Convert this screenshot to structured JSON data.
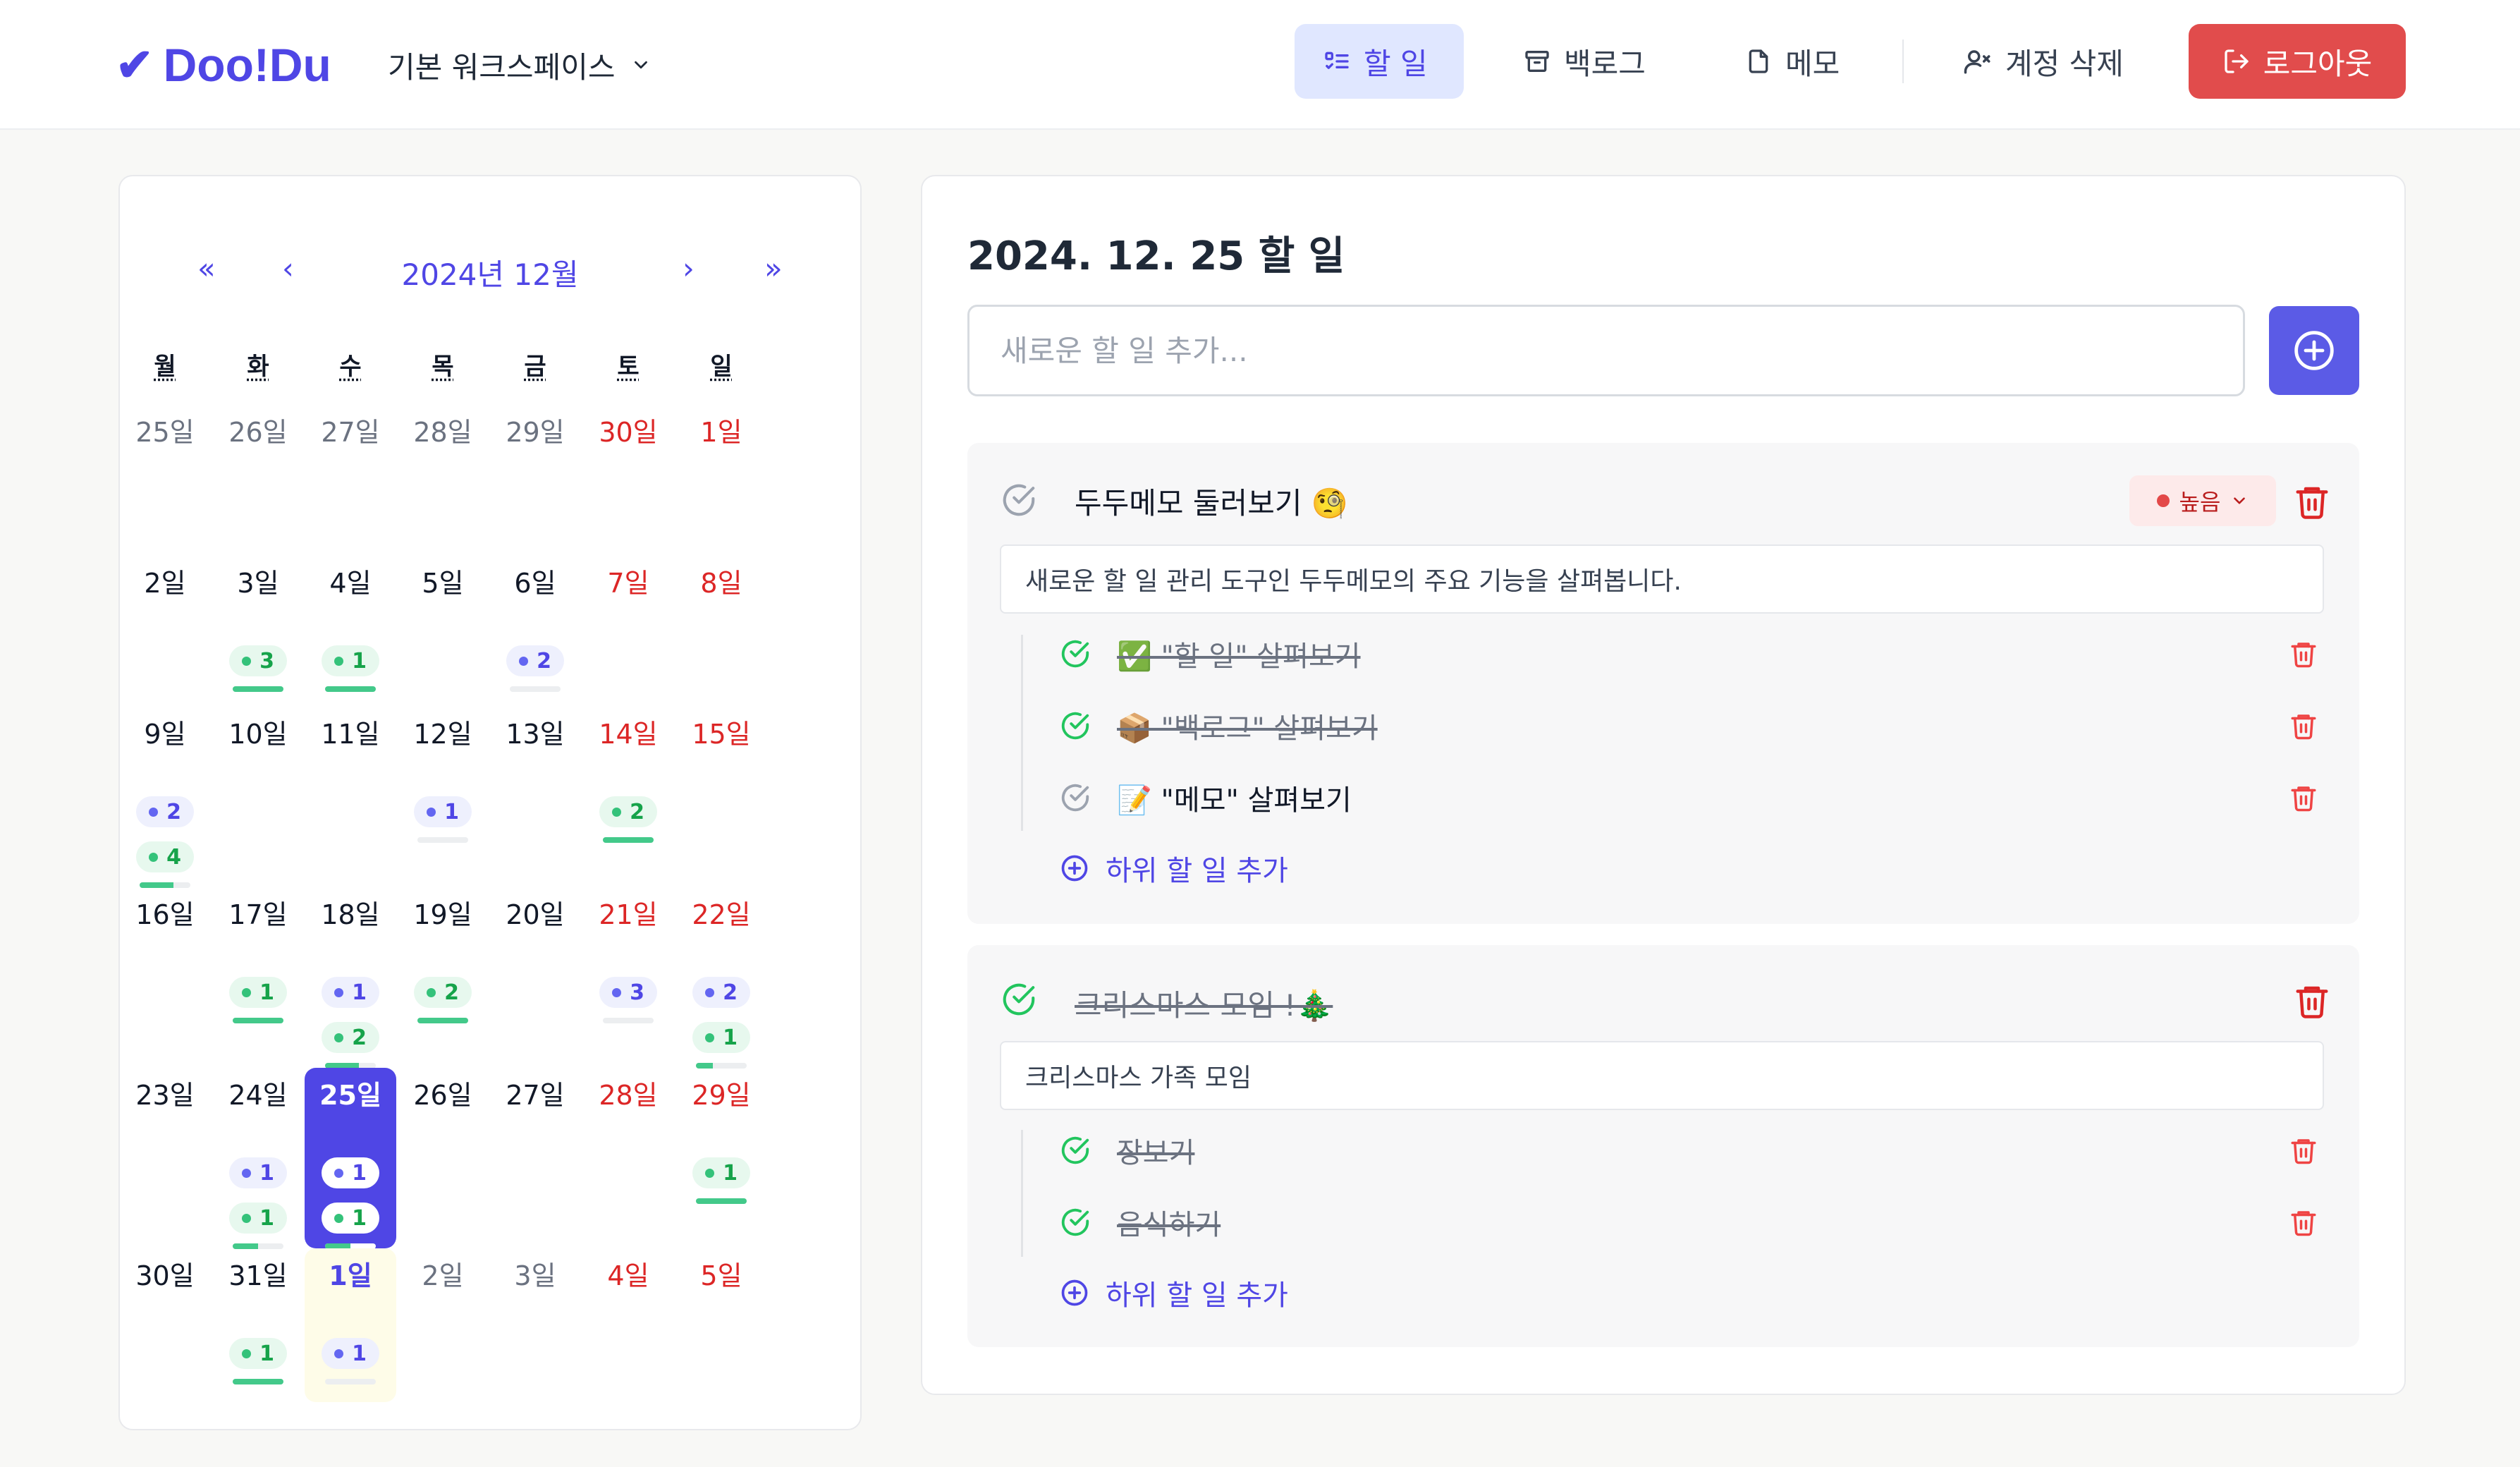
{
  "header": {
    "logo_text": "Doo!Du",
    "workspace": "기본 워크스페이스",
    "nav": {
      "todo": "할 일",
      "backlog": "백로그",
      "memo": "메모",
      "delete_account": "계정 삭제"
    },
    "logout": "로그아웃",
    "colors": {
      "brand": "#4f46e5",
      "logout_bg": "#e14c4c"
    }
  },
  "calendar": {
    "nav": {
      "prev_year": "«",
      "prev_month": "‹",
      "next_month": "›",
      "next_year": "»"
    },
    "title": "2024년 12월",
    "weekdays": [
      "월",
      "화",
      "수",
      "목",
      "금",
      "토",
      "일"
    ],
    "weeks": [
      [
        {
          "label": "25일",
          "other": true
        },
        {
          "label": "26일",
          "other": true
        },
        {
          "label": "27일",
          "other": true
        },
        {
          "label": "28일",
          "other": true
        },
        {
          "label": "29일",
          "other": true
        },
        {
          "label": "30일",
          "weekend": true
        },
        {
          "label": "1일",
          "weekend": true
        }
      ],
      [
        {
          "label": "2일"
        },
        {
          "label": "3일",
          "badges": [
            {
              "color": "green",
              "count": "3"
            }
          ],
          "progress": 1.0
        },
        {
          "label": "4일",
          "badges": [
            {
              "color": "green",
              "count": "1"
            }
          ],
          "progress": 1.0
        },
        {
          "label": "5일"
        },
        {
          "label": "6일",
          "badges": [
            {
              "color": "blue",
              "count": "2"
            }
          ],
          "progress": 0.0
        },
        {
          "label": "7일",
          "weekend": true
        },
        {
          "label": "8일",
          "weekend": true
        }
      ],
      [
        {
          "label": "9일",
          "badges": [
            {
              "color": "blue",
              "count": "2"
            },
            {
              "color": "green",
              "count": "4"
            }
          ],
          "progress": 0.67
        },
        {
          "label": "10일"
        },
        {
          "label": "11일"
        },
        {
          "label": "12일",
          "badges": [
            {
              "color": "blue",
              "count": "1"
            }
          ],
          "progress": 0.0
        },
        {
          "label": "13일"
        },
        {
          "label": "14일",
          "weekend": true,
          "badges": [
            {
              "color": "green",
              "count": "2"
            }
          ],
          "progress": 1.0
        },
        {
          "label": "15일",
          "weekend": true
        }
      ],
      [
        {
          "label": "16일"
        },
        {
          "label": "17일",
          "badges": [
            {
              "color": "green",
              "count": "1"
            }
          ],
          "progress": 1.0
        },
        {
          "label": "18일",
          "badges": [
            {
              "color": "blue",
              "count": "1"
            },
            {
              "color": "green",
              "count": "2"
            }
          ],
          "progress": 0.67
        },
        {
          "label": "19일",
          "badges": [
            {
              "color": "green",
              "count": "2"
            }
          ],
          "progress": 1.0
        },
        {
          "label": "20일"
        },
        {
          "label": "21일",
          "weekend": true,
          "badges": [
            {
              "color": "blue",
              "count": "3"
            }
          ],
          "progress": 0.0
        },
        {
          "label": "22일",
          "weekend": true,
          "badges": [
            {
              "color": "blue",
              "count": "2"
            },
            {
              "color": "green",
              "count": "1"
            }
          ],
          "progress": 0.33
        }
      ],
      [
        {
          "label": "23일"
        },
        {
          "label": "24일",
          "badges": [
            {
              "color": "blue",
              "count": "1"
            },
            {
              "color": "green",
              "count": "1"
            }
          ],
          "progress": 0.5
        },
        {
          "label": "25일",
          "selected": true,
          "badges": [
            {
              "color": "blue",
              "count": "1"
            },
            {
              "color": "green",
              "count": "1"
            }
          ],
          "progress": 0.5
        },
        {
          "label": "26일"
        },
        {
          "label": "27일"
        },
        {
          "label": "28일",
          "weekend": true
        },
        {
          "label": "29일",
          "weekend": true,
          "badges": [
            {
              "color": "green",
              "count": "1"
            }
          ],
          "progress": 1.0
        }
      ],
      [
        {
          "label": "30일"
        },
        {
          "label": "31일",
          "badges": [
            {
              "color": "green",
              "count": "1"
            }
          ],
          "progress": 1.0
        },
        {
          "label": "1일",
          "highlight": true,
          "badges": [
            {
              "color": "blue",
              "count": "1"
            }
          ],
          "progress": 0.0
        },
        {
          "label": "2일",
          "other": true
        },
        {
          "label": "3일",
          "other": true
        },
        {
          "label": "4일",
          "weekend": true
        },
        {
          "label": "5일",
          "weekend": true
        }
      ]
    ]
  },
  "todo": {
    "date_title": "2024. 12. 25 할 일",
    "new_placeholder": "새로운 할 일 추가...",
    "items": [
      {
        "title": "두두메모 둘러보기 🧐",
        "done": false,
        "priority": "높음",
        "description": "새로운 할 일 관리 도구인 두두메모의 주요 기능을 살펴봅니다.",
        "subtasks": [
          {
            "text": "✅ \"할 일\" 살펴보기",
            "done": true
          },
          {
            "text": "📦 \"백로그\" 살펴보기",
            "done": true
          },
          {
            "text": "📝 \"메모\" 살펴보기",
            "done": false
          }
        ],
        "add_sub": "하위 할 일 추가"
      },
      {
        "title": "크리스마스 모임 !🎄",
        "done": true,
        "description": "크리스마스 가족 모임",
        "subtasks": [
          {
            "text": "장보기",
            "done": true
          },
          {
            "text": "음식하기",
            "done": true
          }
        ],
        "add_sub": "하위 할 일 추가"
      }
    ]
  }
}
